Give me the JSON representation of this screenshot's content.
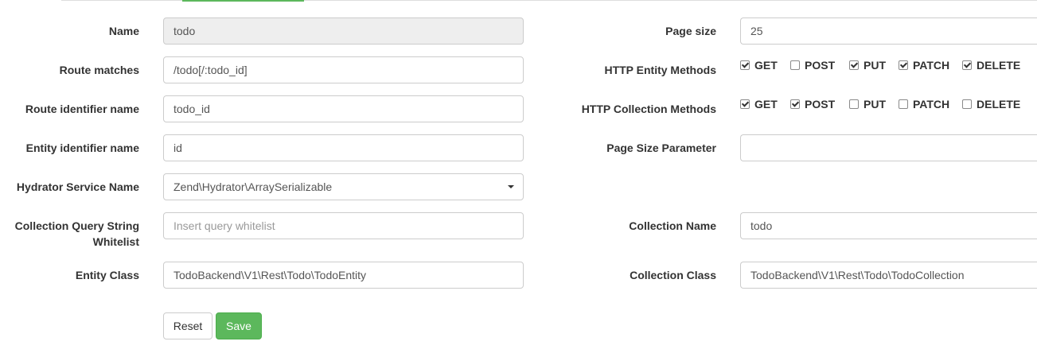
{
  "left": {
    "name": {
      "label": "Name",
      "value": "todo"
    },
    "route_matches": {
      "label": "Route matches",
      "value": "/todo[/:todo_id]"
    },
    "route_identifier": {
      "label": "Route identifier name",
      "value": "todo_id"
    },
    "entity_identifier": {
      "label": "Entity identifier name",
      "value": "id"
    },
    "hydrator": {
      "label": "Hydrator Service Name",
      "value": "Zend\\Hydrator\\ArraySerializable"
    },
    "query_whitelist": {
      "label_line1": "Collection Query String",
      "label_line2": "Whitelist",
      "value": "",
      "placeholder": "Insert query whitelist"
    },
    "entity_class": {
      "label": "Entity Class",
      "value": "TodoBackend\\V1\\Rest\\Todo\\TodoEntity"
    }
  },
  "right": {
    "page_size": {
      "label": "Page size",
      "value": "25"
    },
    "entity_methods": {
      "label": "HTTP Entity Methods",
      "items": [
        {
          "name": "GET",
          "checked": true
        },
        {
          "name": "POST",
          "checked": false
        },
        {
          "name": "PUT",
          "checked": true
        },
        {
          "name": "PATCH",
          "checked": true
        },
        {
          "name": "DELETE",
          "checked": true
        }
      ]
    },
    "collection_methods": {
      "label": "HTTP Collection Methods",
      "items": [
        {
          "name": "GET",
          "checked": true
        },
        {
          "name": "POST",
          "checked": true
        },
        {
          "name": "PUT",
          "checked": false
        },
        {
          "name": "PATCH",
          "checked": false
        },
        {
          "name": "DELETE",
          "checked": false
        }
      ]
    },
    "page_size_param": {
      "label": "Page Size Parameter",
      "value": ""
    },
    "collection_name": {
      "label": "Collection Name",
      "value": "todo"
    },
    "collection_class": {
      "label": "Collection Class",
      "value": "TodoBackend\\V1\\Rest\\Todo\\TodoCollection"
    }
  },
  "actions": {
    "reset_label": "Reset",
    "save_label": "Save"
  },
  "colors": {
    "save_button": "#5cb85c",
    "tab_accent": "#5cb85c",
    "readonly_bg": "#eeeeee"
  }
}
